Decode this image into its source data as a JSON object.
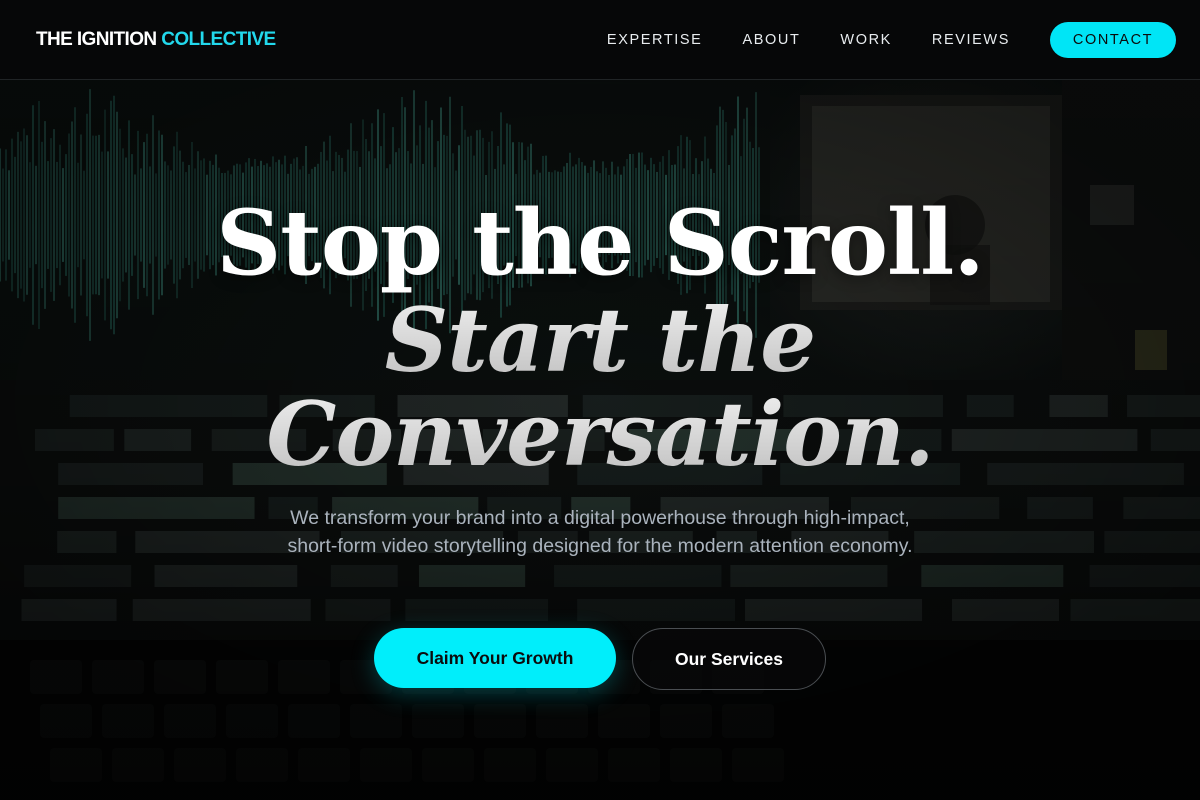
{
  "brand": {
    "name_primary": "THE IGNITION",
    "name_accent": "COLLECTIVE"
  },
  "nav": {
    "items": [
      {
        "label": "EXPERTISE"
      },
      {
        "label": "ABOUT"
      },
      {
        "label": "WORK"
      },
      {
        "label": "REVIEWS"
      }
    ],
    "contact_label": "CONTACT"
  },
  "hero": {
    "headline_line1": "Stop the Scroll.",
    "headline_line2": "Start the",
    "headline_line3": "Conversation.",
    "subtext": "We transform your brand into a digital powerhouse through high-impact, short-form video storytelling designed for the modern attention economy.",
    "primary_cta": "Claim Your Growth",
    "secondary_cta": "Our Services"
  },
  "colors": {
    "accent": "#00e5f6",
    "background": "#060707",
    "body_text": "#aab3bd"
  }
}
